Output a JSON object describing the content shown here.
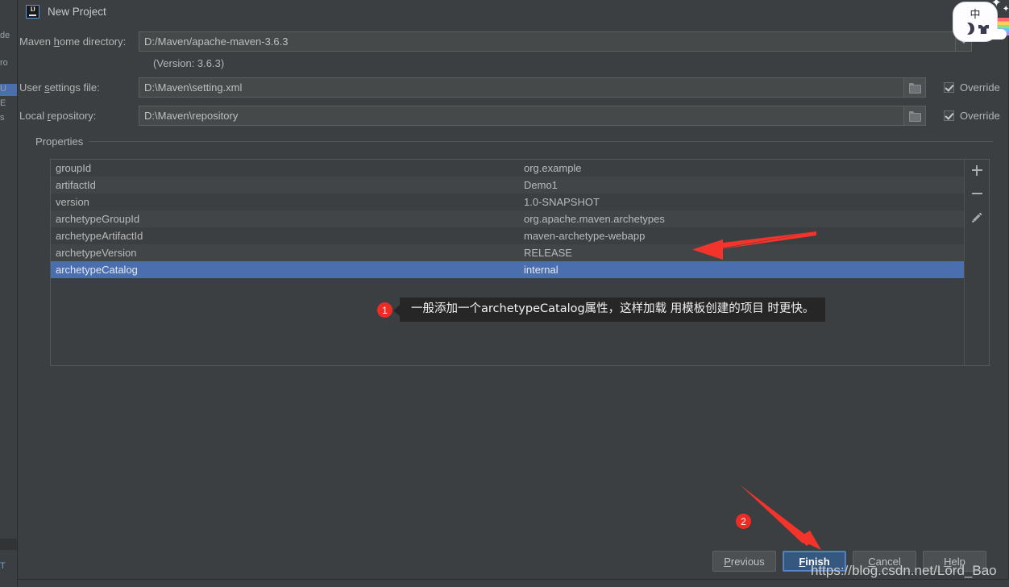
{
  "window": {
    "title": "New Project",
    "app_icon": "intellij-idea-icon"
  },
  "background_app": {
    "strips": [
      "de",
      "ro",
      "U",
      "E",
      "s",
      "T"
    ]
  },
  "form": {
    "maven_home": {
      "label_pre": "Maven ",
      "label_mnemonic": "h",
      "label_post": "ome directory:",
      "value": "D:/Maven/apache-maven-3.6.3",
      "control": "combobox"
    },
    "version_note": "(Version: 3.6.3)",
    "user_settings": {
      "label_pre": "User ",
      "label_mnemonic": "s",
      "label_post": "ettings file:",
      "value": "D:\\Maven\\setting.xml",
      "browse_icon": "folder-icon",
      "override_label": "Override",
      "override_checked": true
    },
    "local_repository": {
      "label_pre": "Local ",
      "label_mnemonic": "r",
      "label_post": "epository:",
      "value": "D:\\Maven\\repository",
      "browse_icon": "folder-icon",
      "override_label": "Override",
      "override_checked": true
    }
  },
  "properties": {
    "group_title": "Properties",
    "rows": [
      {
        "key": "groupId",
        "value": "org.example",
        "selected": false
      },
      {
        "key": "artifactId",
        "value": "Demo1",
        "selected": false
      },
      {
        "key": "version",
        "value": "1.0-SNAPSHOT",
        "selected": false
      },
      {
        "key": "archetypeGroupId",
        "value": "org.apache.maven.archetypes",
        "selected": false
      },
      {
        "key": "archetypeArtifactId",
        "value": "maven-archetype-webapp",
        "selected": false
      },
      {
        "key": "archetypeVersion",
        "value": "RELEASE",
        "selected": false
      },
      {
        "key": "archetypeCatalog",
        "value": "internal",
        "selected": true
      }
    ],
    "tools": [
      {
        "name": "add-property-button",
        "icon": "plus-icon"
      },
      {
        "name": "remove-property-button",
        "icon": "minus-icon"
      },
      {
        "name": "edit-property-button",
        "icon": "pencil-icon"
      }
    ]
  },
  "annotations": {
    "badge_one": "1",
    "badge_two": "2",
    "tooltip_text": "一般添加一个archetypeCatalog属性，这样加载 用模板创建的项目 时更快。",
    "arrow_color": "#f4342b",
    "badge_color": "#ee2b24"
  },
  "buttons": {
    "previous": {
      "pre": "",
      "mnemonic": "P",
      "post": "revious"
    },
    "finish": {
      "pre": "",
      "mnemonic": "F",
      "post": "inish"
    },
    "cancel": {
      "pre": "",
      "mnemonic": "C",
      "post": "ancel"
    },
    "help": {
      "pre": "",
      "mnemonic": "H",
      "post": "elp"
    }
  },
  "watermark": "https://blog.csdn.net/Lord_Bao",
  "ime": {
    "mode_label": "中",
    "icons": [
      "moon-icon",
      "shirt-icon",
      "rainbow-icon",
      "star-icon"
    ]
  },
  "colors": {
    "dialog_bg": "#3c3f41",
    "field_bg": "#45494a",
    "selection": "#4b6eaf",
    "primary_button": "#365880",
    "accent_red": "#ee2b24"
  }
}
